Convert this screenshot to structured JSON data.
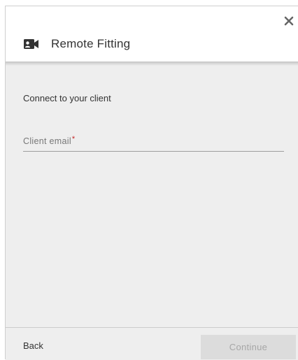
{
  "header": {
    "title": "Remote Fitting",
    "title_icon": "video-camera-icon",
    "close_icon": "close-icon"
  },
  "body": {
    "subtitle": "Connect to your client",
    "email_field": {
      "label": "Client email",
      "required_mark": "*",
      "value": ""
    }
  },
  "footer": {
    "back_label": "Back",
    "continue_label": "Continue",
    "continue_enabled": false
  },
  "colors": {
    "body_background": "#eeeeee",
    "required": "#c62828",
    "disabled_button": "#dcdcdc"
  }
}
